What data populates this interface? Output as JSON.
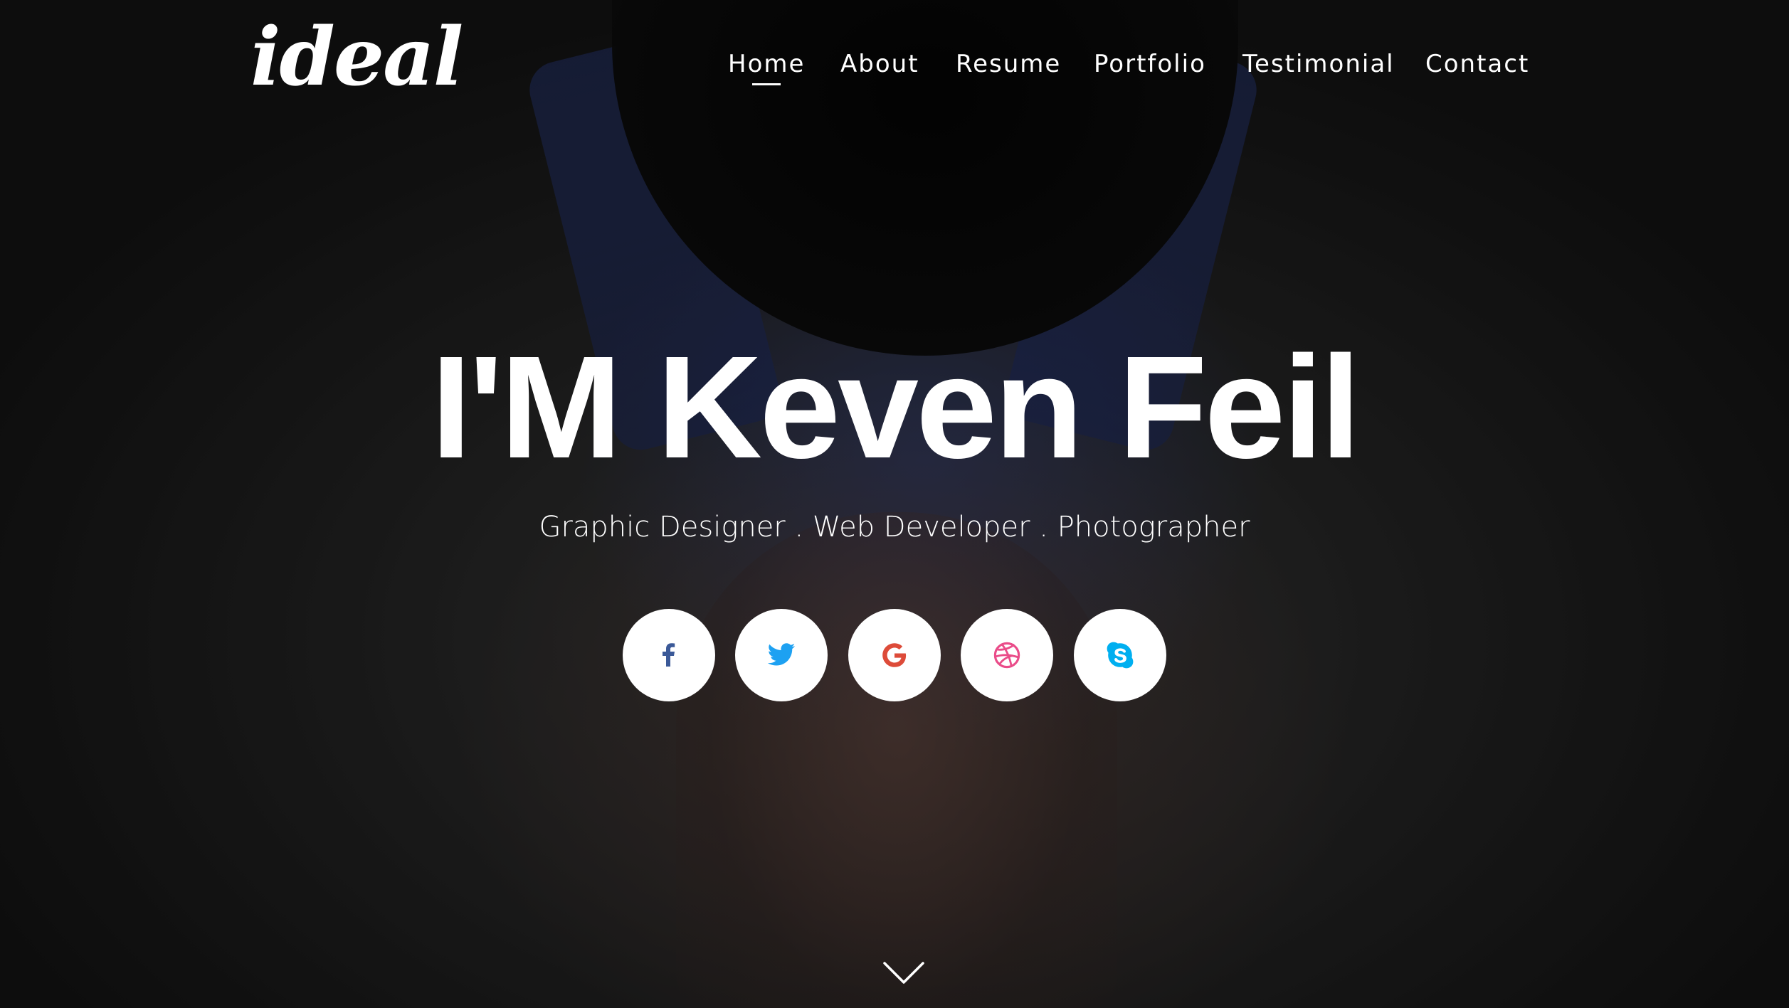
{
  "brand": {
    "logo_text": "ideal"
  },
  "nav": {
    "items": [
      {
        "label": "Home",
        "active": true
      },
      {
        "label": "About",
        "active": false
      },
      {
        "label": "Resume",
        "active": false
      },
      {
        "label": "Portfolio",
        "active": false
      },
      {
        "label": "Testimonial",
        "active": false
      },
      {
        "label": "Contact",
        "active": false
      }
    ]
  },
  "hero": {
    "title": "I'M Keven Feil",
    "subtitle": "Graphic Designer . Web Developer . Photographer"
  },
  "social": [
    {
      "icon": "facebook-icon",
      "color": "#3b5998"
    },
    {
      "icon": "twitter-icon",
      "color": "#1da1f2"
    },
    {
      "icon": "google-icon",
      "color": "#dd4b39"
    },
    {
      "icon": "dribbble-icon",
      "color": "#ea4c89"
    },
    {
      "icon": "skype-icon",
      "color": "#00aff0"
    }
  ],
  "scroll": {
    "icon": "chevron-down-icon",
    "color": "#ffffff"
  }
}
